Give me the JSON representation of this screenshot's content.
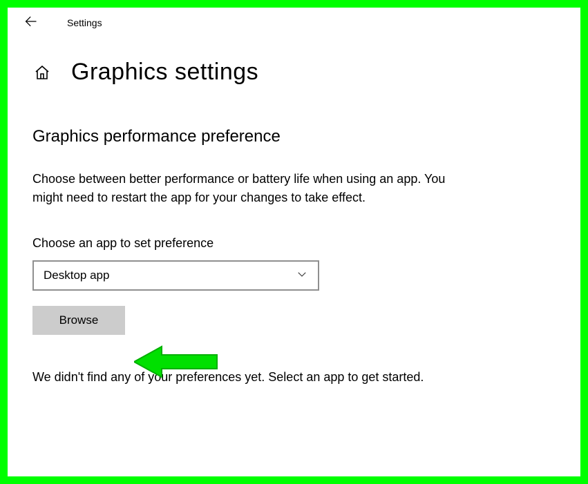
{
  "titlebar": {
    "title": "Settings"
  },
  "page": {
    "title": "Graphics settings"
  },
  "section": {
    "heading": "Graphics performance preference",
    "description": "Choose between better performance or battery life when using an app. You might need to restart the app for your changes to take effect.",
    "field_label": "Choose an app to set preference",
    "dropdown_value": "Desktop app",
    "browse_label": "Browse",
    "footer_text": "We didn't find any of your preferences yet. Select an app to get started."
  },
  "annotation": {
    "arrow_color": "#00ff00"
  }
}
